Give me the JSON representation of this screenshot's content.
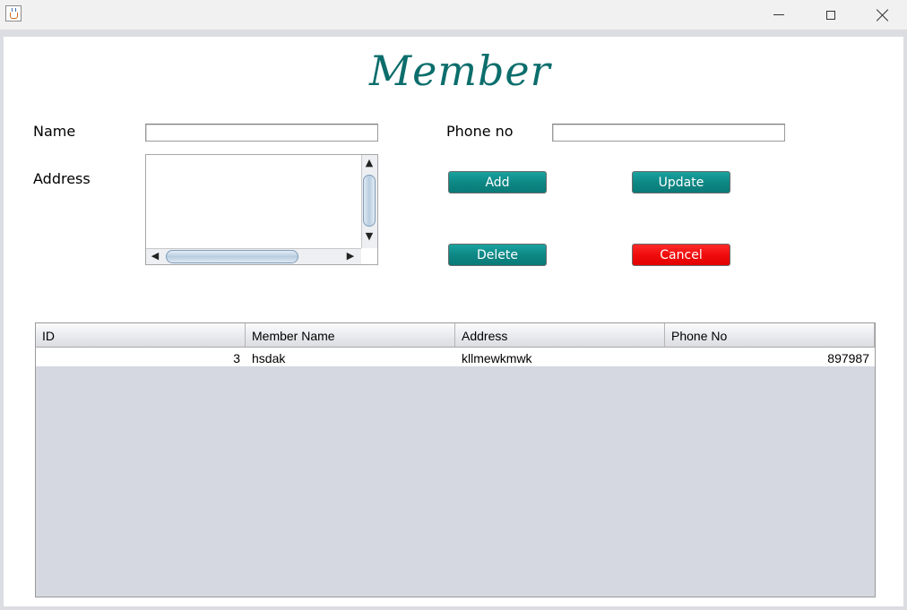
{
  "form": {
    "title": "Member",
    "name_label": "Name",
    "name_value": "",
    "phone_label": "Phone no",
    "phone_value": "",
    "address_label": "Address",
    "address_value": ""
  },
  "buttons": {
    "add": "Add",
    "update": "Update",
    "delete": "Delete",
    "cancel": "Cancel"
  },
  "colors": {
    "title": "#0c6e6c",
    "button_teal": "#0e8885",
    "button_red": "#f00c0c"
  },
  "table": {
    "columns": [
      "ID",
      "Member Name",
      "Address",
      "Phone No"
    ],
    "rows": [
      [
        "3",
        "hsdak",
        "kllmewkmwk",
        "897987"
      ]
    ]
  }
}
